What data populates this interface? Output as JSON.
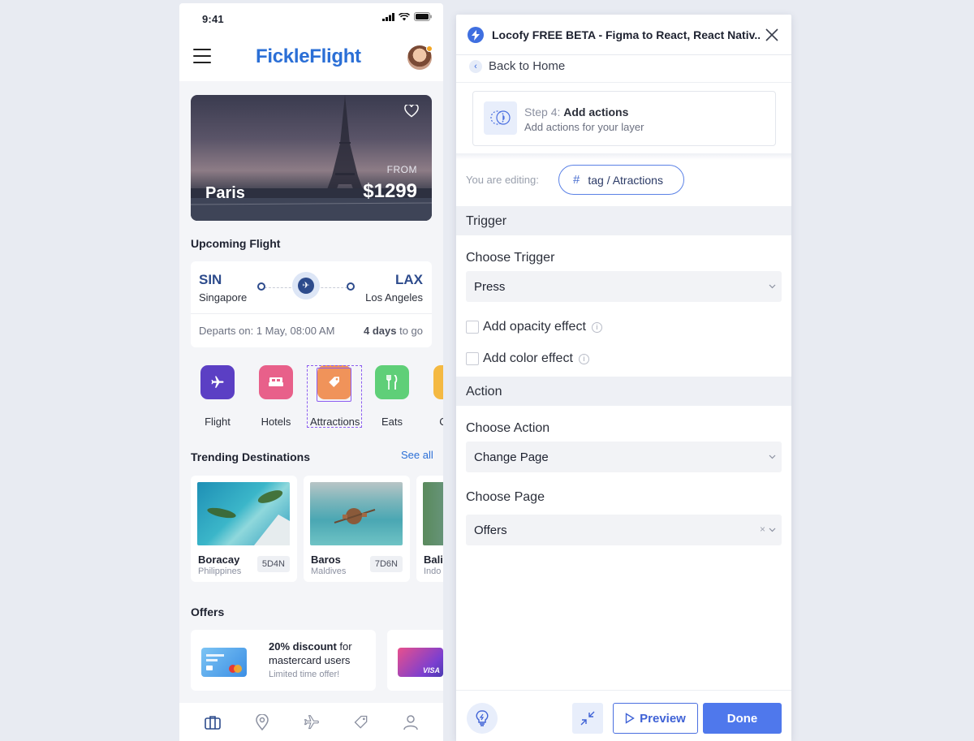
{
  "phone": {
    "status": {
      "time": "9:41"
    },
    "header": {
      "logo": "FickleFlight"
    },
    "hero": {
      "city": "Paris",
      "from_label": "FROM",
      "price": "$1299"
    },
    "upcoming": {
      "title": "Upcoming Flight",
      "from_code": "SIN",
      "from_city": "Singapore",
      "to_code": "LAX",
      "to_city": "Los Angeles",
      "departs": "Departs on: 1 May, 08:00 AM",
      "days_bold": "4 days",
      "days_rest": " to go"
    },
    "categories": [
      {
        "label": "Flight",
        "icon": "plane-icon",
        "color": "#5b3fc4"
      },
      {
        "label": "Hotels",
        "icon": "bed-icon",
        "color": "#e8608a"
      },
      {
        "label": "Attractions",
        "icon": "tag-icon",
        "color": "#f0935a"
      },
      {
        "label": "Eats",
        "icon": "utensils-icon",
        "color": "#5fcf78"
      },
      {
        "label": "Com",
        "icon": "more-icon",
        "color": "#f4b942"
      }
    ],
    "trending": {
      "title": "Trending Destinations",
      "see_all": "See all",
      "items": [
        {
          "name": "Boracay",
          "country": "Philippines",
          "badge": "5D4N"
        },
        {
          "name": "Baros",
          "country": "Maldives",
          "badge": "7D6N"
        },
        {
          "name": "Bali",
          "country": "Indo"
        }
      ]
    },
    "offers": {
      "title": "Offers",
      "items": [
        {
          "title_bold": "20% discount",
          "title_rest": " for mastercard users",
          "sub": "Limited time offer!"
        }
      ],
      "second_card_text": "VISA"
    }
  },
  "panel": {
    "title": "Locofy FREE BETA - Figma to React, React Nativ...",
    "back": "Back to Home",
    "step": {
      "prefix": "Step 4: ",
      "title": "Add actions",
      "sub": "Add actions for your layer"
    },
    "editing_label": "You are editing:",
    "editing_tag": "tag / Atractions",
    "trigger_section": "Trigger",
    "choose_trigger_label": "Choose Trigger",
    "trigger_value": "Press",
    "opacity_label": "Add opacity effect",
    "color_label": "Add color effect",
    "action_section": "Action",
    "choose_action_label": "Choose Action",
    "action_value": "Change Page",
    "choose_page_label": "Choose Page",
    "page_value": "Offers",
    "preview_label": "Preview",
    "done_label": "Done",
    "accent": "#4f78ec"
  }
}
